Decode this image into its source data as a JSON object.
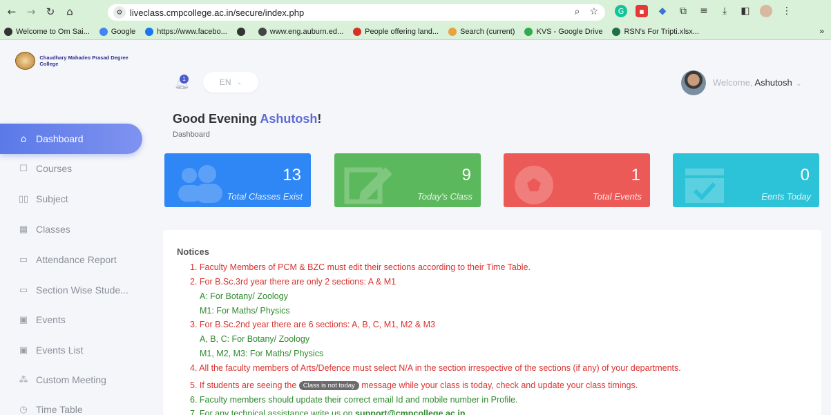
{
  "browser": {
    "url": "liveclass.cmpcollege.ac.in/secure/index.php",
    "bookmarks": [
      {
        "label": "Welcome to Om Sai...",
        "color": "#333333"
      },
      {
        "label": "Google",
        "color": "#4285f4"
      },
      {
        "label": "https://www.facebo...",
        "color": "#1877f2"
      },
      {
        "label": "",
        "color": "#333333"
      },
      {
        "label": "www.eng.auburn.ed...",
        "color": "#444444"
      },
      {
        "label": "People offering land...",
        "color": "#d93025"
      },
      {
        "label": "Search (current)",
        "color": "#e8a33d"
      },
      {
        "label": "KVS - Google Drive",
        "color": "#34a853"
      },
      {
        "label": "RSN's For Tripti.xlsx...",
        "color": "#1e7145"
      }
    ],
    "more_label": "»"
  },
  "sidebar": {
    "logo_title": "Chaudhary Mahadeo Prasad Degree College",
    "items": [
      {
        "label": "Dashboard",
        "icon": "home-icon",
        "glyph": "⌂",
        "active": true
      },
      {
        "label": "Courses",
        "icon": "bookmark-icon",
        "glyph": "☐",
        "active": false
      },
      {
        "label": "Subject",
        "icon": "book-icon",
        "glyph": "▯▯",
        "active": false
      },
      {
        "label": "Classes",
        "icon": "grid-icon",
        "glyph": "▦",
        "active": false
      },
      {
        "label": "Attendance Report",
        "icon": "monitor-icon",
        "glyph": "▭",
        "active": false
      },
      {
        "label": "Section Wise Stude...",
        "icon": "monitor-icon",
        "glyph": "▭",
        "active": false
      },
      {
        "label": "Events",
        "icon": "event-icon",
        "glyph": "▣",
        "active": false
      },
      {
        "label": "Events List",
        "icon": "event-icon",
        "glyph": "▣",
        "active": false
      },
      {
        "label": "Custom Meeting",
        "icon": "meeting-icon",
        "glyph": "⁂",
        "active": false
      },
      {
        "label": "Time Table",
        "icon": "clock-icon",
        "glyph": "◷",
        "active": false
      }
    ]
  },
  "header": {
    "notification_count": "1",
    "language": "EN",
    "welcome_prefix": "Welcome,",
    "user_name": "Ashutosh"
  },
  "main": {
    "greeting_prefix": "Good Evening",
    "greeting_name": "Ashutosh",
    "greeting_suffix": "!",
    "breadcrumb": "Dashboard",
    "cards": [
      {
        "value": "13",
        "label": "Total Classes Exist",
        "color": "#2f87f5",
        "icon": "users-icon"
      },
      {
        "value": "9",
        "label": "Today's Class",
        "color": "#5cb85c",
        "icon": "edit-icon"
      },
      {
        "value": "1",
        "label": "Total Events",
        "color": "#ec5a57",
        "icon": "soccer-ball-icon"
      },
      {
        "value": "0",
        "label": "Eents Today",
        "color": "#2cc3d9",
        "icon": "calendar-check-icon"
      }
    ]
  },
  "notices": {
    "title": "Notices",
    "lines": [
      {
        "text": "1. Faculty Members of PCM & BZC must edit their sections according to their Time Table.",
        "color": "red",
        "indent": 0
      },
      {
        "text": "2. For B.Sc.3rd year there are only 2 sections: A & M1",
        "color": "red",
        "indent": 0
      },
      {
        "text": "A: For Botany/ Zoology",
        "color": "green",
        "indent": 1
      },
      {
        "text": "M1: For Maths/ Physics",
        "color": "green",
        "indent": 1
      },
      {
        "text": "3. For B.Sc.2nd year there are 6 sections: A, B, C, M1, M2 & M3",
        "color": "red",
        "indent": 0
      },
      {
        "text": "A, B, C: For Botany/ Zoology",
        "color": "green",
        "indent": 1
      },
      {
        "text": "M1, M2, M3: For Maths/ Physics",
        "color": "green",
        "indent": 1
      },
      {
        "text": "4. All the faculty members of Arts/Defence must select N/A in the section irrespective of the sections (if any) of your departments.",
        "color": "red",
        "indent": 0
      }
    ],
    "line5_before": "5. If students are seeing the",
    "line5_pill": "Class is not today",
    "line5_after": "message while your class is today, check and update your class timings.",
    "line6": "6. Faculty members should update their correct email Id and mobile number in Profile.",
    "line7_before": "7. For any technical assistance write us on",
    "line7_email": "support@cmpcollege.ac.in"
  }
}
